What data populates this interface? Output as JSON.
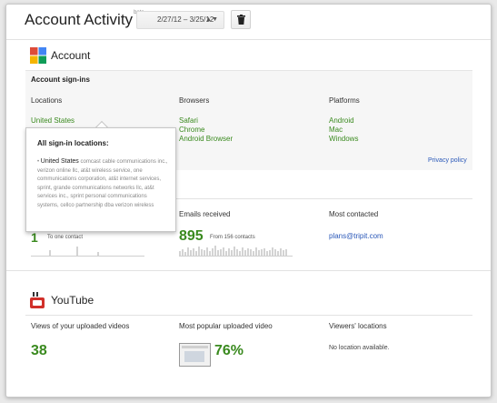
{
  "header": {
    "title": "Account Activity",
    "beta": "beta",
    "date_range": "2/27/12 – 3/25/12"
  },
  "account": {
    "section_title": "Account",
    "subheading": "Account sign-ins",
    "columns": {
      "locations": {
        "label": "Locations",
        "items": [
          "United States"
        ]
      },
      "browsers": {
        "label": "Browsers",
        "items": [
          "Safari",
          "Chrome",
          "Android Browser"
        ]
      },
      "platforms": {
        "label": "Platforms",
        "items": [
          "Android",
          "Mac",
          "Windows"
        ]
      }
    },
    "privacy_link": "Privacy policy",
    "popup": {
      "title": "All sign-in locations:",
      "country": "United States",
      "providers": "comcast cable communications inc., verizon online llc, at&t wireless service, one communications corporation, at&t internet services, sprint, grande communications networks llc, at&t services inc., sprint personal communications systems, cellco partnership dba verizon wireless"
    }
  },
  "gmail_stats": {
    "sent_value": "1",
    "sent_note": "To one contact",
    "received_label": "Emails received",
    "received_value": "895",
    "received_note": "From 156 contacts",
    "contacted_label": "Most contacted",
    "contacted_value": "plans@tripit.com"
  },
  "youtube": {
    "section_title": "YouTube",
    "views_label": "Views of your uploaded videos",
    "views_value": "38",
    "popular_label": "Most popular uploaded video",
    "popular_value": "76%",
    "locations_label": "Viewers' locations",
    "locations_value": "No location available."
  },
  "colors": {
    "accent_green": "#3a8a1f",
    "link_blue": "#2a58b8",
    "youtube_red": "#d1302a"
  },
  "icons": {
    "google_logo": "google-account-icon",
    "youtube_logo": "youtube-icon",
    "trash": "trash-icon",
    "select_arrows": "updown-arrows-icon"
  }
}
